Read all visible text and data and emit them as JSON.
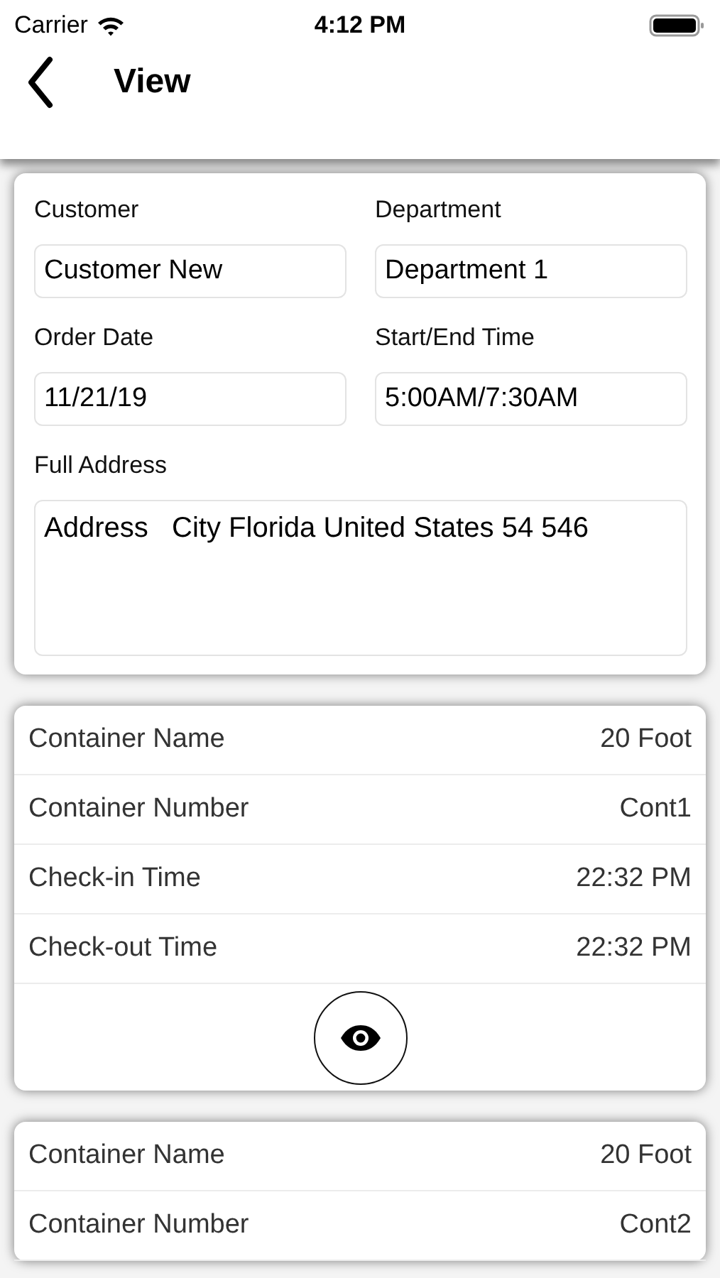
{
  "status_bar": {
    "carrier": "Carrier",
    "time": "4:12 PM"
  },
  "nav": {
    "title": "View"
  },
  "order": {
    "fields": [
      {
        "label": "Customer",
        "value": "Customer New"
      },
      {
        "label": "Department",
        "value": "Department 1"
      },
      {
        "label": "Order Date",
        "value": "11/21/19"
      },
      {
        "label": "Start/End Time",
        "value": "5:00AM/7:30AM"
      }
    ],
    "address": {
      "label": "Full Address",
      "value": "Address   City Florida United States 54 546"
    }
  },
  "containers": [
    {
      "rows": [
        {
          "label": "Container Name",
          "value": "20 Foot"
        },
        {
          "label": "Container Number",
          "value": "Cont1"
        },
        {
          "label": "Check-in Time",
          "value": "22:32 PM"
        },
        {
          "label": "Check-out Time",
          "value": "22:32 PM"
        }
      ],
      "view_button": true
    },
    {
      "rows": [
        {
          "label": "Container Name",
          "value": "20 Foot"
        },
        {
          "label": "Container Number",
          "value": "Cont2"
        }
      ],
      "view_button": false
    }
  ]
}
